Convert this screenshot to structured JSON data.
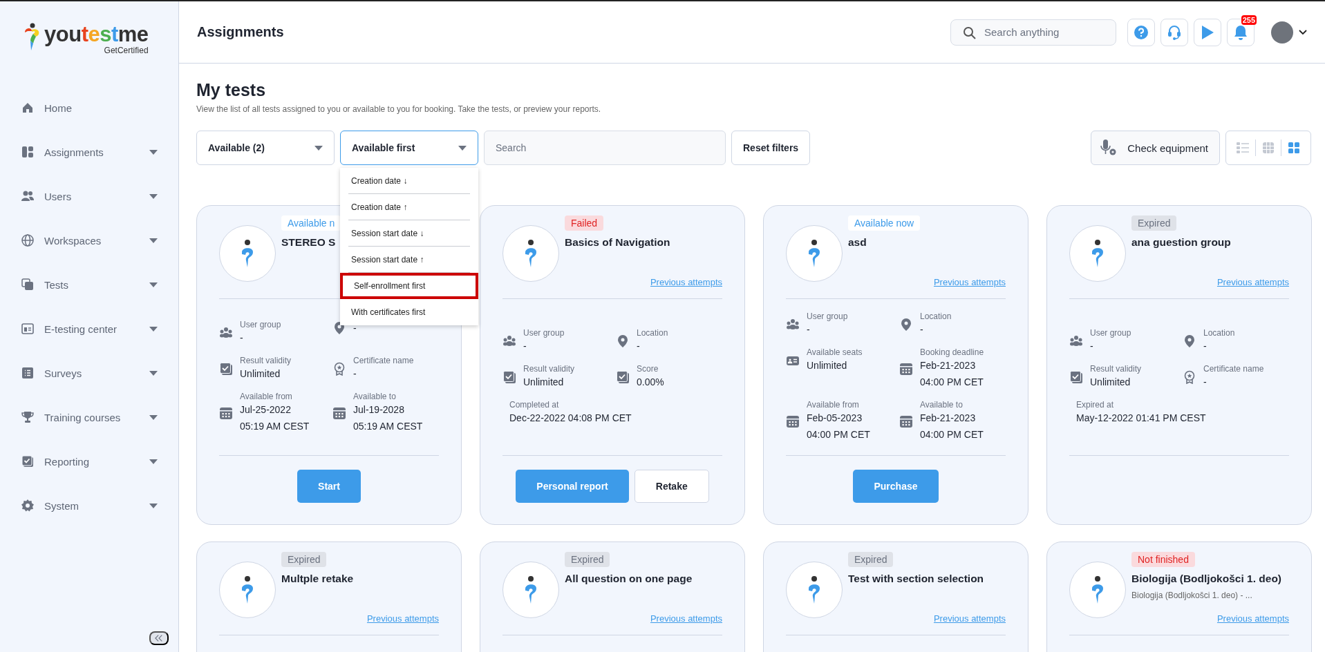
{
  "sidebar": {
    "logo": {
      "parts": [
        {
          "text": "you",
          "color": "#333333"
        },
        {
          "text": "t",
          "color": "#e8431e"
        },
        {
          "text": "e",
          "color": "#f5a623"
        },
        {
          "text": "s",
          "color": "#4caf50"
        },
        {
          "text": "t",
          "color": "#3d9be9"
        },
        {
          "text": "me",
          "color": "#333333"
        }
      ],
      "tagline": "GetCertified"
    },
    "items": [
      {
        "label": "Home",
        "kind": "home",
        "has_submenu": false
      },
      {
        "label": "Assignments",
        "kind": "assignments",
        "has_submenu": true
      },
      {
        "label": "Users",
        "kind": "users",
        "has_submenu": true
      },
      {
        "label": "Workspaces",
        "kind": "workspaces",
        "has_submenu": true
      },
      {
        "label": "Tests",
        "kind": "tests",
        "has_submenu": true
      },
      {
        "label": "E-testing center",
        "kind": "etesting",
        "has_submenu": true
      },
      {
        "label": "Surveys",
        "kind": "surveys",
        "has_submenu": true
      },
      {
        "label": "Training courses",
        "kind": "training",
        "has_submenu": true
      },
      {
        "label": "Reporting",
        "kind": "reporting",
        "has_submenu": true
      },
      {
        "label": "System",
        "kind": "system",
        "has_submenu": true
      }
    ]
  },
  "header": {
    "title": "Assignments",
    "search": {
      "placeholder": "Search anything"
    },
    "notification_count": "255"
  },
  "page": {
    "title": "My tests",
    "description": "View the list of all tests assigned to you or available to you for booking. Take the tests, or preview your reports."
  },
  "toolbar": {
    "status_filter": "Available (2)",
    "sort": {
      "value": "Available first",
      "open": true,
      "options": [
        {
          "label": "Creation date ↓",
          "highlighted": false
        },
        {
          "label": "Creation date ↑",
          "highlighted": false
        },
        {
          "label": "Session start date ↓",
          "highlighted": false
        },
        {
          "label": "Session start date ↑",
          "highlighted": false
        },
        {
          "label": "Self-enrollment first",
          "highlighted": true
        },
        {
          "label": "With certificates first",
          "highlighted": false
        }
      ]
    },
    "search": {
      "placeholder": "Search"
    },
    "reset_button": "Reset filters",
    "check_equipment_button": "Check equipment",
    "views": [
      {
        "kind": "list",
        "selected": false
      },
      {
        "kind": "grid",
        "selected": false
      },
      {
        "kind": "cards",
        "selected": true
      }
    ]
  },
  "cards": [
    {
      "status": {
        "label": "Available n",
        "kind": "available"
      },
      "title": "STEREO S",
      "fields": [
        {
          "kind": "group",
          "label": "User group",
          "value": [
            "-"
          ]
        },
        {
          "kind": "location",
          "value": [
            "-"
          ]
        },
        {
          "kind": "validity",
          "label": "Result validity",
          "value": [
            "Unlimited"
          ]
        },
        {
          "kind": "certificate",
          "label": "Certificate name",
          "value": [
            "-"
          ]
        },
        {
          "kind": "date",
          "label": "Available from",
          "value": [
            "Jul-25-2022",
            "05:19 AM CEST"
          ]
        },
        {
          "kind": "date",
          "label": "Available to",
          "value": [
            "Jul-19-2028",
            "05:19 AM CEST"
          ]
        }
      ],
      "buttons": [
        {
          "label": "Start",
          "kind": "primary"
        }
      ]
    },
    {
      "status": {
        "label": "Failed",
        "kind": "failed"
      },
      "title": "Basics of Navigation",
      "previous_attempts": "Previous attempts",
      "fields": [
        {
          "kind": "group",
          "label": "User group",
          "value": [
            "-"
          ]
        },
        {
          "kind": "location",
          "label": "Location",
          "value": [
            "-"
          ]
        },
        {
          "kind": "validity",
          "label": "Result validity",
          "value": [
            "Unlimited"
          ]
        },
        {
          "kind": "validity",
          "label": "Score",
          "value": [
            "0.00%"
          ]
        },
        {
          "kind": "date",
          "label": "Completed at",
          "value": [
            "Dec-22-2022 04:08 PM CET"
          ]
        }
      ],
      "buttons": [
        {
          "label": "Personal report",
          "kind": "primary"
        },
        {
          "label": "Retake",
          "kind": "secondary"
        }
      ]
    },
    {
      "status": {
        "label": "Available now",
        "kind": "available"
      },
      "title": "asd",
      "previous_attempts": "Previous attempts",
      "fields": [
        {
          "kind": "group",
          "label": "User group",
          "value": [
            "-"
          ]
        },
        {
          "kind": "location",
          "label": "Location",
          "value": [
            "-"
          ]
        },
        {
          "kind": "seats",
          "label": "Available seats",
          "value": [
            "Unlimited"
          ]
        },
        {
          "kind": "date",
          "label": "Booking deadline",
          "value": [
            "Feb-21-2023",
            "04:00 PM CET"
          ]
        },
        {
          "kind": "date",
          "label": "Available from",
          "value": [
            "Feb-05-2023",
            "04:00 PM CET"
          ]
        },
        {
          "kind": "date",
          "label": "Available to",
          "value": [
            "Feb-21-2023",
            "04:00 PM CET"
          ]
        }
      ],
      "buttons": [
        {
          "label": "Purchase",
          "kind": "primary"
        }
      ]
    },
    {
      "status": {
        "label": "Expired",
        "kind": "expired"
      },
      "title": "ana guestion group",
      "previous_attempts": "Previous attempts",
      "fields": [
        {
          "kind": "group",
          "label": "User group",
          "value": [
            "-"
          ]
        },
        {
          "kind": "location",
          "label": "Location",
          "value": [
            "-"
          ]
        },
        {
          "kind": "validity",
          "label": "Result validity",
          "value": [
            "Unlimited"
          ]
        },
        {
          "kind": "certificate",
          "label": "Certificate name",
          "value": [
            "-"
          ]
        },
        {
          "kind": "date",
          "label": "Expired at",
          "value": [
            "May-12-2022 01:41 PM CEST"
          ]
        }
      ]
    },
    {
      "status": {
        "label": "Expired",
        "kind": "expired"
      },
      "title": "Multple retake",
      "previous_attempts": "Previous attempts"
    },
    {
      "status": {
        "label": "Expired",
        "kind": "expired"
      },
      "title": "All question on one page",
      "previous_attempts": "Previous attempts"
    },
    {
      "status": {
        "label": "Expired",
        "kind": "expired"
      },
      "title": "Test with section selection",
      "previous_attempts": "Previous attempts"
    },
    {
      "status": {
        "label": "Not finished",
        "kind": "failed"
      },
      "title": "Biologija (Bodljokošci 1. deo)",
      "subtitle": "Biologija (Bodljokošci 1. deo) - ...",
      "previous_attempts": "Previous attempts"
    }
  ]
}
